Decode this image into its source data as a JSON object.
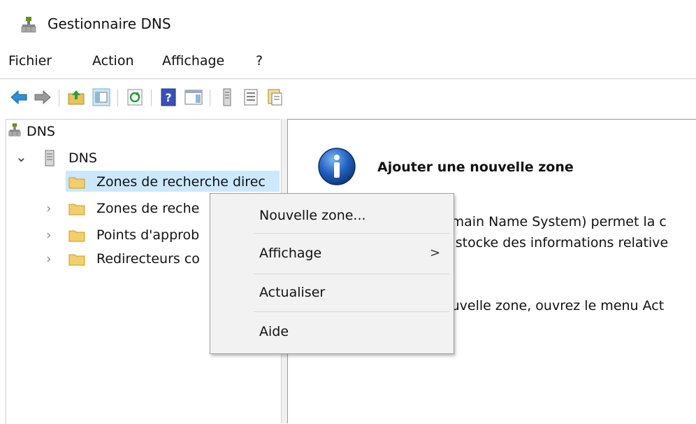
{
  "window": {
    "title": "Gestionnaire DNS"
  },
  "menubar": {
    "items": [
      "Fichier",
      "Action",
      "Affichage",
      "?"
    ]
  },
  "toolbar": {
    "buttons": [
      "back-icon",
      "forward-icon",
      "up-folder-icon",
      "show-hide-tree-icon",
      "refresh-icon",
      "help-icon",
      "show-action-pane-icon",
      "server-icon",
      "list-icon",
      "properties-icon"
    ]
  },
  "tree": {
    "root": "DNS",
    "server": "DNS",
    "zones": [
      "Zones de recherche direc",
      "Zones de reche",
      "Points d'approb",
      "Redirecteurs co"
    ],
    "chevrons": {
      "expanded": "⌄",
      "collapsed": "›"
    }
  },
  "details": {
    "title": "Ajouter une nouvelle zone",
    "lines": [
      "omain Name System) permet la c",
      "e stocke des informations relative",
      "ouvelle zone, ouvrez le menu Act"
    ]
  },
  "context_menu": {
    "items": [
      {
        "label": "Nouvelle zone...",
        "submenu": false
      },
      {
        "label": "Affichage",
        "submenu": true,
        "arrow": ">"
      },
      {
        "label": "Actualiser",
        "submenu": false
      },
      {
        "label": "Aide",
        "submenu": false
      }
    ]
  },
  "colors": {
    "selection": "#cce8ff",
    "menu_bg": "#f2f2f2",
    "info_blue": "#1f5fbf"
  }
}
